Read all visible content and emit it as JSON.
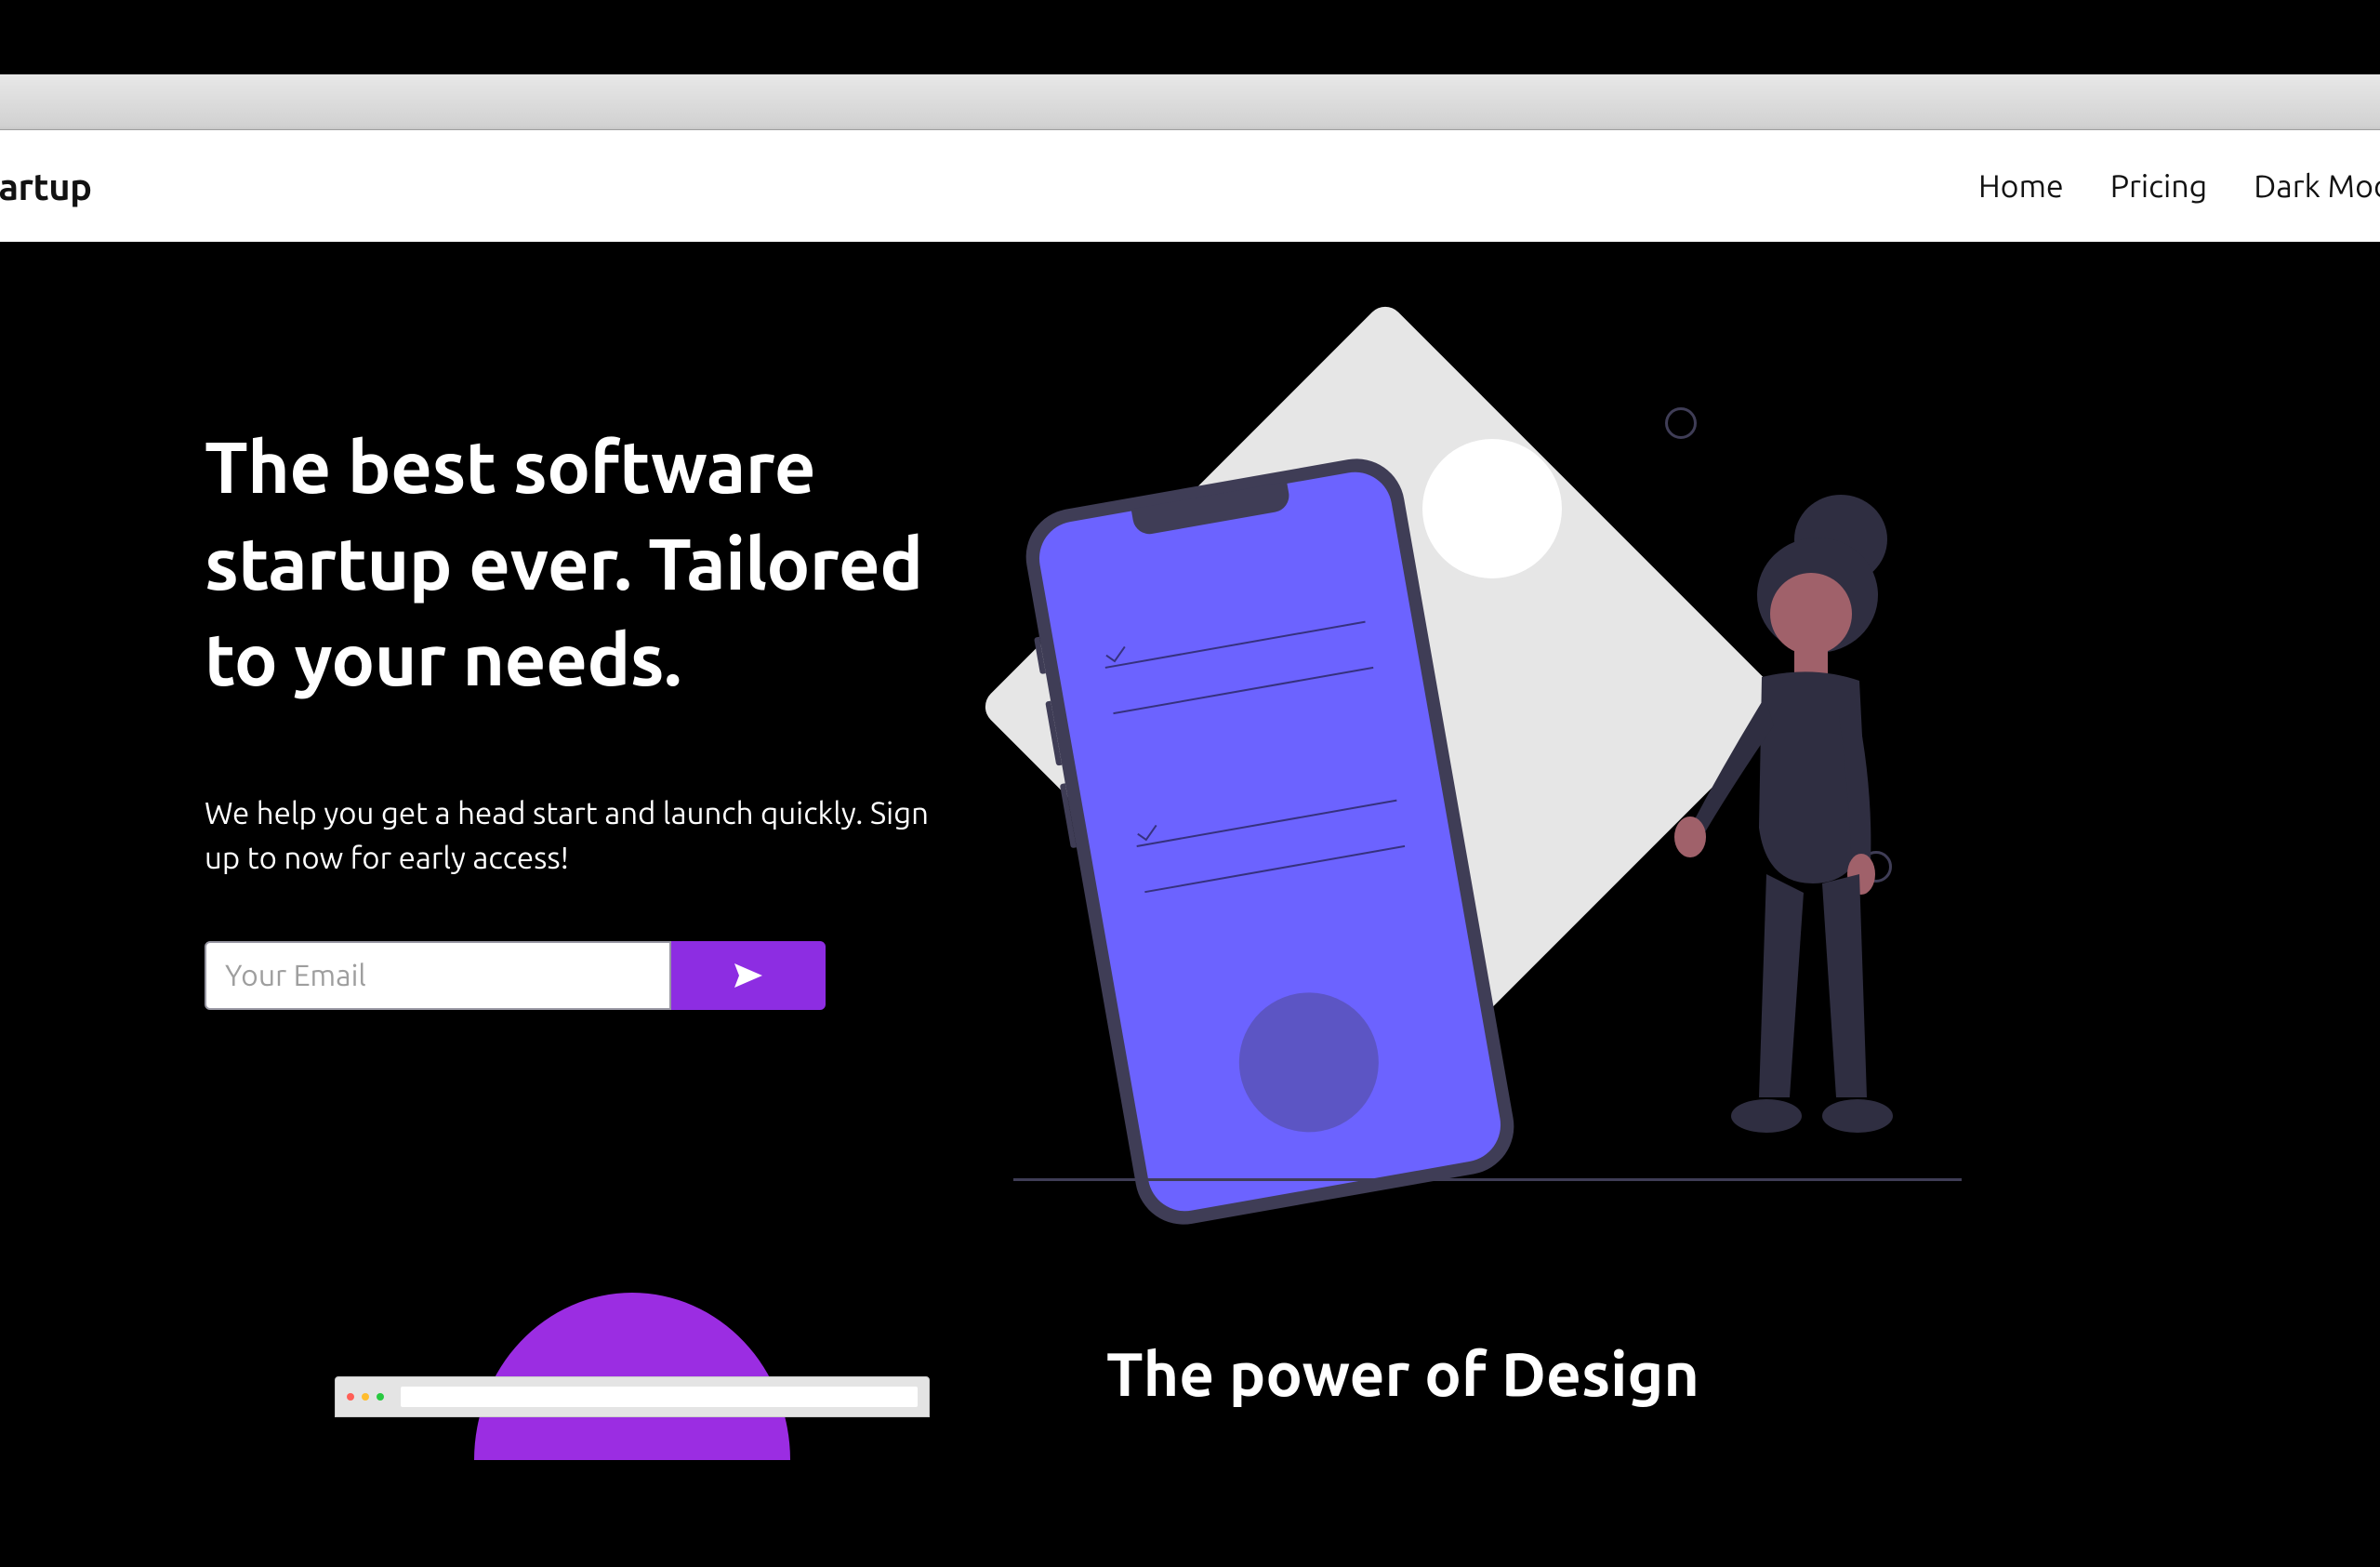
{
  "brand": "Startup",
  "nav": {
    "items": [
      "Home",
      "Pricing",
      "Dark Mode:"
    ]
  },
  "hero": {
    "title": "The best software startup ever. Tailored to your needs.",
    "subtitle": "We help you get a head start and launch quickly. Sign up to now for early access!",
    "email_placeholder": "Your Email"
  },
  "section2": {
    "title": "The power of Design"
  },
  "colors": {
    "accent": "#8d2de2",
    "phone_screen": "#6c63ff",
    "dark": "#3f3d56"
  }
}
